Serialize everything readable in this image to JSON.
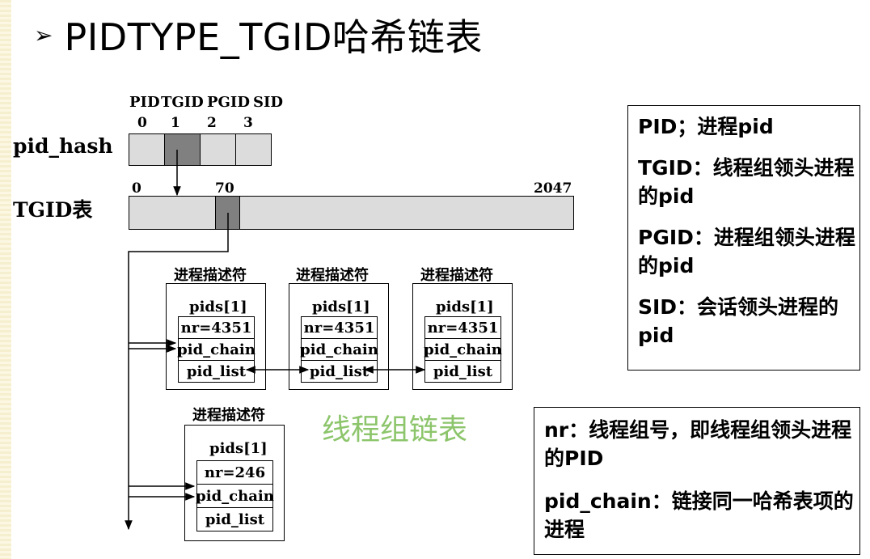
{
  "title": {
    "bullet": "➢",
    "text": "PIDTYPE_TGID哈希链表"
  },
  "pid_hash": {
    "label": "pid_hash",
    "column_headers": [
      "PID",
      "TGID",
      "PGID",
      "SID"
    ],
    "indices": [
      "0",
      "1",
      "2",
      "3"
    ]
  },
  "tgid_table": {
    "label": "TGID表",
    "start": "0",
    "mid": "70",
    "end": "2047"
  },
  "descriptors": [
    {
      "title": "进程描述符",
      "pids": "pids[1]",
      "nr": "nr=4351",
      "chain": "pid_chain",
      "list": "pid_list"
    },
    {
      "title": "进程描述符",
      "pids": "pids[1]",
      "nr": "nr=4351",
      "chain": "pid_chain",
      "list": "pid_list"
    },
    {
      "title": "进程描述符",
      "pids": "pids[1]",
      "nr": "nr=4351",
      "chain": "pid_chain",
      "list": "pid_list"
    },
    {
      "title": "进程描述符",
      "pids": "pids[1]",
      "nr": "nr=246",
      "chain": "pid_chain",
      "list": "pid_list"
    }
  ],
  "group_list_label": "线程组链表",
  "legend_top": [
    "PID；进程pid",
    "TGID：线程组领头进程的pid",
    "PGID：进程组领头进程的pid",
    "SID：会话领头进程的pid"
  ],
  "legend_bottom": [
    "nr：线程组号，即线程组领头进程的PID",
    "pid_chain：链接同一哈希表项的进程"
  ],
  "colors": {
    "highlight_cell": "#808080",
    "normal_cell": "#dcdcdc",
    "group_label": "#8cc56b"
  }
}
